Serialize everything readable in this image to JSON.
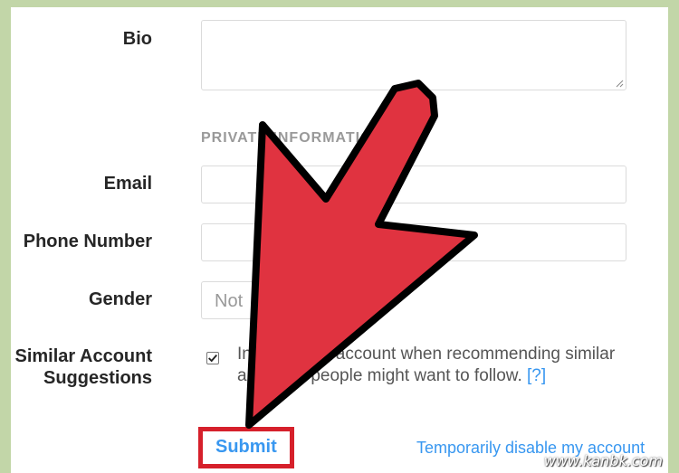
{
  "form": {
    "bio_label": "Bio",
    "section_heading": "PRIVATE INFORMATION",
    "email_label": "Email",
    "phone_label": "Phone Number",
    "gender_label": "Gender",
    "gender_value": "Not",
    "similar_label_line1": "Similar Account",
    "similar_label_line2": "Suggestions",
    "similar_checked": true,
    "similar_text": "Include your account when recommending similar accounts people might want to follow.",
    "help_link": "[?]",
    "submit_label": "Submit",
    "disable_link": "Temporarily disable my account"
  },
  "annotation": {
    "arrow_color": "#e03340",
    "highlight_color": "#d6202b"
  },
  "watermark": "www.kanbk.com"
}
